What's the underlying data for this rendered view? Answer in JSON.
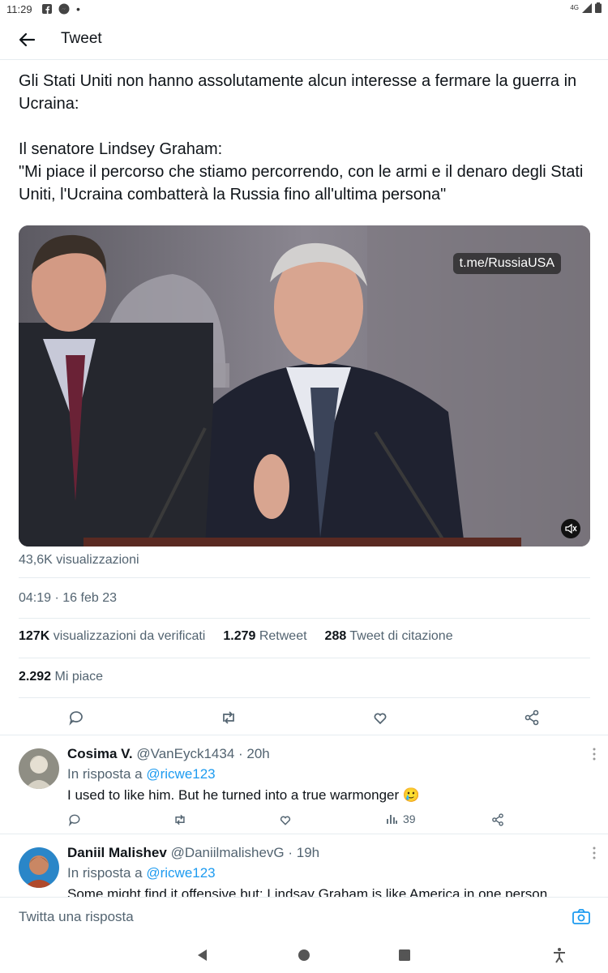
{
  "status_bar": {
    "time": "11:29",
    "icons": [
      "facebook-icon",
      "messenger-icon",
      "dot-icon",
      "signal-icon",
      "battery-icon"
    ],
    "network_label": "4G"
  },
  "header": {
    "title": "Tweet"
  },
  "tweet": {
    "paragraphs": [
      "Gli Stati Uniti non hanno assolutamente alcun interesse a fermare la guerra in Ucraina:",
      "Il senatore Lindsey Graham:\n\"Mi piace il percorso che stiamo percorrendo, con le armi e il denaro degli Stati Uniti, l'Ucraina combatterà la Russia fino all'ultima persona\""
    ],
    "media_watermark": "t.me/RussiaUSA",
    "views": "43,6K visualizzazioni",
    "timestamp": "04:19 · 16 feb 23",
    "stats": {
      "verified_views_count": "127K",
      "verified_views_label": "visualizzazioni da verificati",
      "retweets_count": "1.279",
      "retweets_label": "Retweet",
      "quotes_count": "288",
      "quotes_label": "Tweet di citazione",
      "likes_count": "2.292",
      "likes_label": "Mi piace"
    }
  },
  "replies": [
    {
      "name": "Cosima V.",
      "handle": "@VanEyck1434",
      "time": "· 20h",
      "reply_to_prefix": "In risposta a",
      "reply_to_handle": "@ricwe123",
      "text": "I used to like him. But he turned into a true warmonger 🥲",
      "views": "39"
    },
    {
      "name": "Daniil Malishev",
      "handle": "@DaniilmalishevG",
      "time": "· 19h",
      "reply_to_prefix": "In risposta a",
      "reply_to_handle": "@ricwe123",
      "text": "Some might find it offensive but: Lindsay Graham is like America in one person"
    }
  ],
  "compose": {
    "placeholder": "Twitta una risposta"
  },
  "colors": {
    "accent": "#1d9bf0",
    "text": "#0f1419",
    "secondary": "#536471",
    "divider": "#e6ecf0"
  }
}
